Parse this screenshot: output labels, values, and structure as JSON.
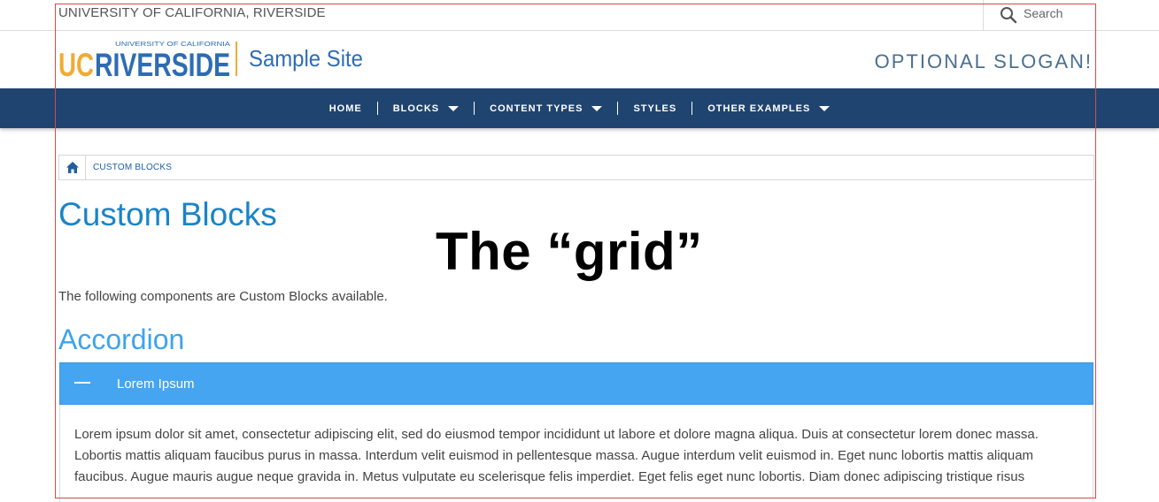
{
  "topbar": {
    "university": "UNIVERSITY OF CALIFORNIA, RIVERSIDE",
    "search_label": "Search"
  },
  "header": {
    "logo_small": "UNIVERSITY OF CALIFORNIA",
    "logo_uc": "UC",
    "logo_riverside": "RIVERSIDE",
    "site_name": "Sample Site",
    "slogan": "OPTIONAL SLOGAN!"
  },
  "nav": {
    "items": [
      {
        "label": "HOME"
      },
      {
        "label": "BLOCKS"
      },
      {
        "label": "CONTENT TYPES"
      },
      {
        "label": "STYLES"
      },
      {
        "label": "OTHER EXAMPLES"
      }
    ]
  },
  "breadcrumb": {
    "current": "CUSTOM BLOCKS"
  },
  "main": {
    "title": "Custom Blocks",
    "overlay_label": "The “grid”",
    "intro": "The following components are Custom Blocks available.",
    "section_title": "Accordion",
    "accordion": {
      "title": "Lorem Ipsum",
      "body": "Lorem ipsum dolor sit amet, consectetur adipiscing elit, sed do eiusmod tempor incididunt ut labore et dolore magna aliqua. Duis at consectetur lorem donec massa. Lobortis mattis aliquam faucibus purus in massa. Interdum velit euismod in pellentesque massa. Augue interdum velit euismod in. Eget nunc lobortis mattis aliquam faucibus. Augue mauris augue neque gravida in. Metus vulputate eu scelerisque felis imperdiet. Eget felis eget nunc lobortis. Diam donec adipiscing tristique risus"
    }
  },
  "colors": {
    "nav_bg": "#1f446f",
    "accent_blue": "#1a84c7",
    "accordion_bg": "#46a5f0",
    "logo_gold": "#f1ab33",
    "logo_blue": "#2d6cb5",
    "grid_outline": "#d24a4a"
  }
}
